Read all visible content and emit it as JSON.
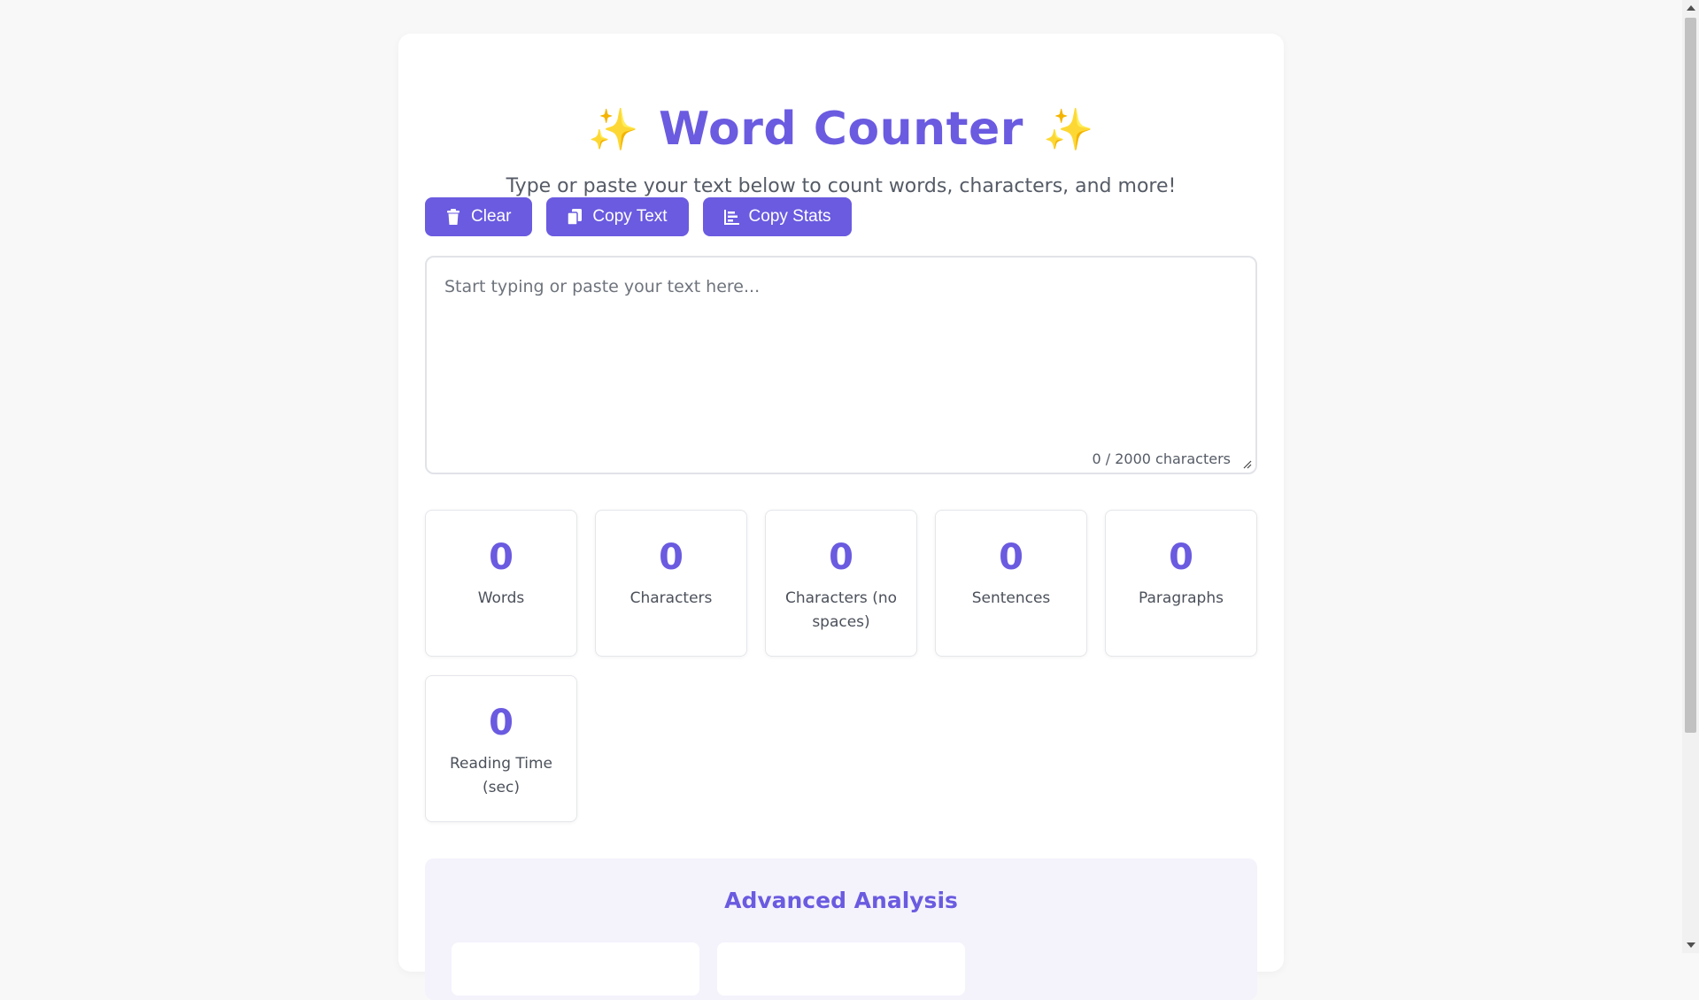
{
  "header": {
    "title": "Word Counter",
    "sparkle_left": "✨",
    "sparkle_right": "✨",
    "subtitle": "Type or paste your text below to count words, characters, and more!"
  },
  "toolbar": {
    "clear_label": "Clear",
    "copy_text_label": "Copy Text",
    "copy_stats_label": "Copy Stats"
  },
  "editor": {
    "placeholder": "Start typing or paste your text here...",
    "value": "",
    "char_count": "0 / 2000 characters"
  },
  "stats": [
    {
      "value": "0",
      "label": "Words"
    },
    {
      "value": "0",
      "label": "Characters"
    },
    {
      "value": "0",
      "label": "Characters (no spaces)"
    },
    {
      "value": "0",
      "label": "Sentences"
    },
    {
      "value": "0",
      "label": "Paragraphs"
    },
    {
      "value": "0",
      "label": "Reading Time (sec)"
    }
  ],
  "advanced": {
    "title": "Advanced Analysis"
  },
  "colors": {
    "accent": "#6a5be0",
    "sparkle": "#f4b63a",
    "background": "#f8f8f8"
  }
}
